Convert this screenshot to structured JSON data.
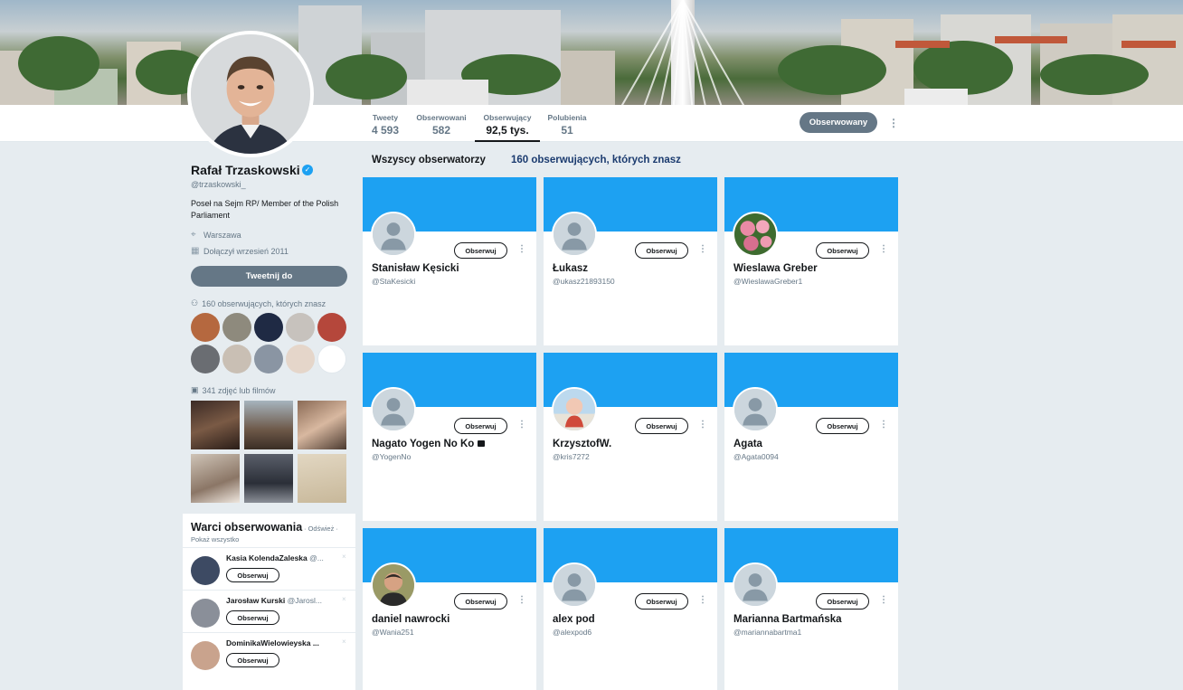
{
  "nav": {
    "stats": [
      {
        "label": "Tweety",
        "value": "4 593"
      },
      {
        "label": "Obserwowani",
        "value": "582"
      },
      {
        "label": "Obserwujący",
        "value": "92,5 tys."
      },
      {
        "label": "Polubienia",
        "value": "51"
      }
    ],
    "follow_button": "Obserwowany",
    "kebab": "⋮"
  },
  "profile": {
    "name": "Rafał Trzaskowski",
    "verified_glyph": "✓",
    "handle": "@trzaskowski_",
    "bio": "Poseł na Sejm RP/ Member of the Polish Parliament",
    "location": "Warszawa",
    "joined": "Dołączył wrzesień 2011",
    "tweet_to": "Tweetnij do",
    "followers_you_know": "160 obserwujących, których znasz",
    "photos": "341 zdjęć lub filmów",
    "icons": {
      "location": "⌖",
      "calendar": "▦",
      "person": "⚇",
      "image": "▣"
    }
  },
  "who_to_follow": {
    "title": "Warci obserwowania",
    "refresh": "· Odśwież ·",
    "show_all": "Pokaż wszystko",
    "dismiss": "×",
    "items": [
      {
        "name": "Kasia KolendaZaleska",
        "handle": "@...",
        "button": "Obserwuj"
      },
      {
        "name": "Jarosław Kurski",
        "handle": "@Jarosl...",
        "button": "Obserwuj"
      },
      {
        "name": "DominikaWielowieyska ...",
        "handle": "",
        "button": "Obserwuj"
      }
    ]
  },
  "tabs": {
    "all": "Wszyscy obserwatorzy",
    "known": "160 obserwujących, których znasz"
  },
  "followers": [
    {
      "name": "Stanisław Kęsicki",
      "handle": "@StaKesicki",
      "button": "Obserwuj",
      "avatar": "default"
    },
    {
      "name": "Łukasz",
      "handle": "@ukasz21893150",
      "button": "Obserwuj",
      "avatar": "default"
    },
    {
      "name": "Wieslawa Greber",
      "handle": "@WieslawaGreber1",
      "button": "Obserwuj",
      "avatar": "flowers"
    },
    {
      "name": "Nagato Yogen No Ko",
      "handle": "@YogenNo",
      "button": "Obserwuj",
      "avatar": "default",
      "locked": true
    },
    {
      "name": "KrzysztofW.",
      "handle": "@kris7272",
      "button": "Obserwuj",
      "avatar": "child"
    },
    {
      "name": "Agata",
      "handle": "@Agata0094",
      "button": "Obserwuj",
      "avatar": "default"
    },
    {
      "name": "daniel nawrocki",
      "handle": "@Wania251",
      "button": "Obserwuj",
      "avatar": "man"
    },
    {
      "name": "alex pod",
      "handle": "@alexpod6",
      "button": "Obserwuj",
      "avatar": "default"
    },
    {
      "name": "Marianna Bartmańska",
      "handle": "@mariannabartma1",
      "button": "Obserwuj",
      "avatar": "default"
    }
  ],
  "colors": {
    "accent": "#1da1f2",
    "muted_button": "#657786",
    "bg": "#e6ecf0"
  }
}
